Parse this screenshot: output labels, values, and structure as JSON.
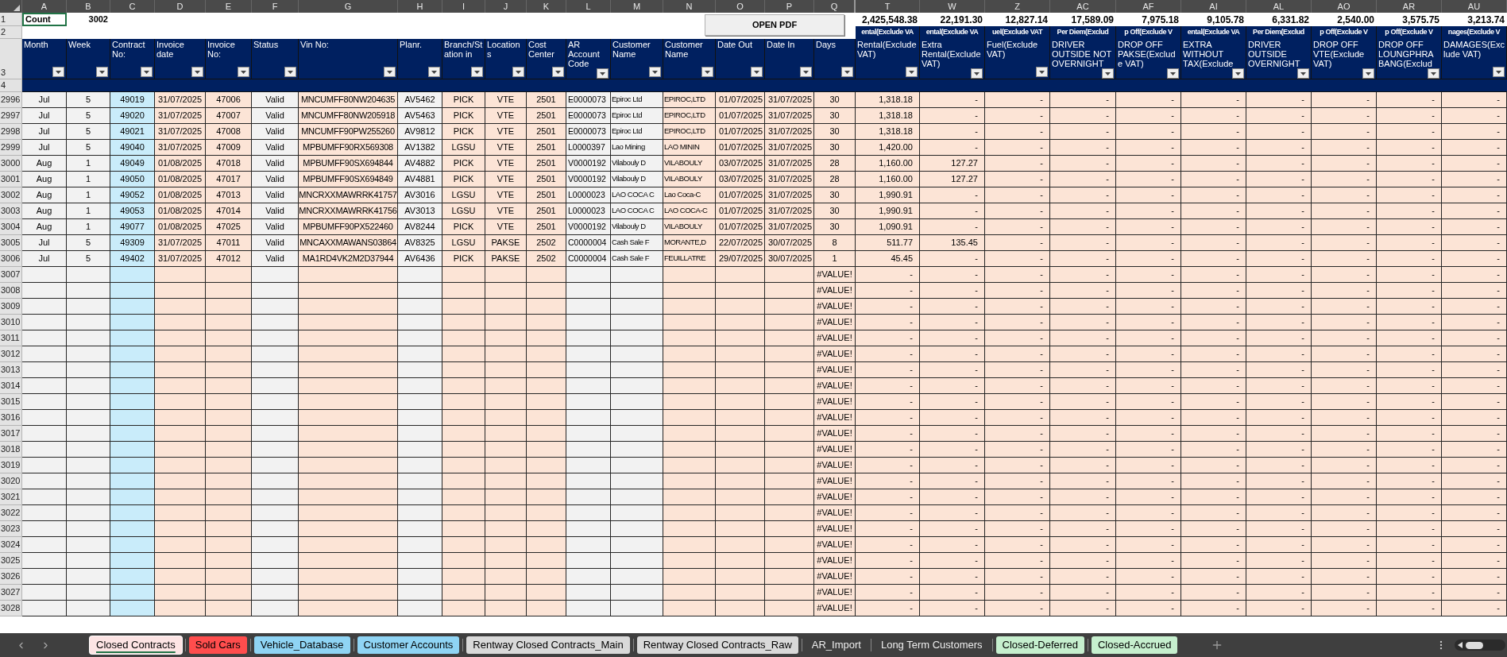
{
  "column_letters": [
    "A",
    "B",
    "C",
    "D",
    "E",
    "F",
    "G",
    "H",
    "I",
    "J",
    "K",
    "L",
    "M",
    "N",
    "O",
    "P",
    "Q",
    "T",
    "W",
    "Z",
    "AC",
    "AF",
    "AI",
    "AL",
    "AO",
    "AR",
    "AU"
  ],
  "top_row_numbers": [
    "1",
    "2",
    "3",
    "4"
  ],
  "row1": {
    "label": "Count",
    "selected": true,
    "count": "3002",
    "totals": [
      "2,425,548.38",
      "22,191.30",
      "12,827.14",
      "17,589.09",
      "7,975.18",
      "9,105.78",
      "6,331.82",
      "2,540.00",
      "3,575.75",
      "3,213.74"
    ]
  },
  "open_pdf_button": "OPEN PDF",
  "group_labels": [
    "ental(Exclude VA",
    "ental(Exclude VA",
    "uel(Exclude VAT",
    "Per Diem(Exclud",
    "p Off(Exclude V",
    "ental(Exclude VA",
    "Per Diem(Exclud",
    "p Off(Exclude V",
    "p Off(Exclude V",
    "nages(Exclude V"
  ],
  "headers": [
    "Month",
    "Week",
    "Contract No:",
    "Invoice date",
    "Invoice No:",
    "Status",
    "Vin No:",
    "Planr.",
    "Branch/Station in",
    "Locations",
    "Cost Center",
    "AR Account Code",
    "Customer Name",
    "Customer Name",
    "Date Out",
    "Date In",
    "Days",
    "Rental(Exclude VAT)",
    "Extra Rental(Exclude VAT)",
    "Fuel(Exclude VAT)",
    "DRIVER OUTSIDE NOT OVERNIGHT",
    "DROP OFF PAKSE(Exclude VAT)",
    "EXTRA WITHOUT TAX(Exclude",
    "DRIVER OUTSIDE OVERNIGHT",
    "DROP OFF VTE(Exclude VAT)",
    "DROP OFF LOUNGPHRABANG(Exclud",
    "DAMAGES(Exclude VAT)"
  ],
  "rows": [
    {
      "number": "2996",
      "cells": [
        "Jul",
        "5",
        "49019",
        "31/07/2025",
        "47006",
        "Valid",
        "MNCUMFF80NW204635",
        "AV5462",
        "PICK",
        "VTE",
        "2501",
        "E0000073",
        "Epiroc Ltd",
        "EPIROC,LTD",
        "01/07/2025",
        "31/07/2025",
        "30",
        "1,318.18",
        "-",
        "-",
        "-",
        "-",
        "-",
        "-",
        "-",
        "-",
        "-"
      ]
    },
    {
      "number": "2997",
      "cells": [
        "Jul",
        "5",
        "49020",
        "31/07/2025",
        "47007",
        "Valid",
        "MNCUMFF80NW205918",
        "AV5463",
        "PICK",
        "VTE",
        "2501",
        "E0000073",
        "Epiroc Ltd",
        "EPIROC,LTD",
        "01/07/2025",
        "31/07/2025",
        "30",
        "1,318.18",
        "-",
        "-",
        "-",
        "-",
        "-",
        "-",
        "-",
        "-",
        "-"
      ]
    },
    {
      "number": "2998",
      "cells": [
        "Jul",
        "5",
        "49021",
        "31/07/2025",
        "47008",
        "Valid",
        "MNCUMFF90PW255260",
        "AV9812",
        "PICK",
        "VTE",
        "2501",
        "E0000073",
        "Epiroc Ltd",
        "EPIROC,LTD",
        "01/07/2025",
        "31/07/2025",
        "30",
        "1,318.18",
        "-",
        "-",
        "-",
        "-",
        "-",
        "-",
        "-",
        "-",
        "-"
      ]
    },
    {
      "number": "2999",
      "cells": [
        "Jul",
        "5",
        "49040",
        "31/07/2025",
        "47009",
        "Valid",
        "MPBUMFF90RX569308",
        "AV1382",
        "LGSU",
        "VTE",
        "2501",
        "L0000397",
        "Lao Mining",
        "LAO MININ",
        "01/07/2025",
        "31/07/2025",
        "30",
        "1,420.00",
        "-",
        "-",
        "-",
        "-",
        "-",
        "-",
        "-",
        "-",
        "-"
      ]
    },
    {
      "number": "3000",
      "cells": [
        "Aug",
        "1",
        "49049",
        "01/08/2025",
        "47018",
        "Valid",
        "MPBUMFF90SX694844",
        "AV4882",
        "PICK",
        "VTE",
        "2501",
        "V0000192",
        "Vilabouly D",
        "VILABOULY",
        "03/07/2025",
        "31/07/2025",
        "28",
        "1,160.00",
        "127.27",
        "-",
        "-",
        "-",
        "-",
        "-",
        "-",
        "-",
        "-"
      ]
    },
    {
      "number": "3001",
      "cells": [
        "Aug",
        "1",
        "49050",
        "01/08/2025",
        "47017",
        "Valid",
        "MPBUMFF90SX694849",
        "AV4881",
        "PICK",
        "VTE",
        "2501",
        "V0000192",
        "Vilabouly D",
        "VILABOULY",
        "03/07/2025",
        "31/07/2025",
        "28",
        "1,160.00",
        "127.27",
        "-",
        "-",
        "-",
        "-",
        "-",
        "-",
        "-",
        "-"
      ]
    },
    {
      "number": "3002",
      "cells": [
        "Aug",
        "1",
        "49052",
        "01/08/2025",
        "47013",
        "Valid",
        "MNCRXXMAWRRK41757",
        "AV3016",
        "LGSU",
        "VTE",
        "2501",
        "L0000023",
        "LAO COCA C",
        "Lao Coca-C",
        "01/07/2025",
        "31/07/2025",
        "30",
        "1,990.91",
        "-",
        "-",
        "-",
        "-",
        "-",
        "-",
        "-",
        "-",
        "-"
      ]
    },
    {
      "number": "3003",
      "cells": [
        "Aug",
        "1",
        "49053",
        "01/08/2025",
        "47014",
        "Valid",
        "MNCRXXMAWRRK41756",
        "AV3013",
        "LGSU",
        "VTE",
        "2501",
        "L0000023",
        "LAO COCA C",
        "LAO COCA-C",
        "01/07/2025",
        "31/07/2025",
        "30",
        "1,990.91",
        "-",
        "-",
        "-",
        "-",
        "-",
        "-",
        "-",
        "-",
        "-"
      ]
    },
    {
      "number": "3004",
      "cells": [
        "Aug",
        "1",
        "49077",
        "01/08/2025",
        "47025",
        "Valid",
        "MPBUMFF90PX522460",
        "AV8244",
        "PICK",
        "VTE",
        "2501",
        "V0000192",
        "Vilabouly D",
        "VILABOULY",
        "01/07/2025",
        "31/07/2025",
        "30",
        "1,090.91",
        "-",
        "-",
        "-",
        "-",
        "-",
        "-",
        "-",
        "-",
        "-"
      ]
    },
    {
      "number": "3005",
      "cells": [
        "Jul",
        "5",
        "49309",
        "31/07/2025",
        "47011",
        "Valid",
        "MNCAXXMAWANS03864",
        "AV8325",
        "LGSU",
        "PAKSE",
        "2502",
        "C0000004",
        "Cash Sale F",
        "MORANTE,D",
        "22/07/2025",
        "30/07/2025",
        "8",
        "511.77",
        "135.45",
        "-",
        "-",
        "-",
        "-",
        "-",
        "-",
        "-",
        "-"
      ]
    },
    {
      "number": "3006",
      "cells": [
        "Jul",
        "5",
        "49402",
        "31/07/2025",
        "47012",
        "Valid",
        "MA1RD4VK2M2D37944",
        "AV6436",
        "PICK",
        "PAKSE",
        "2502",
        "C0000004",
        "Cash Sale F",
        "FEUILLATRE",
        "29/07/2025",
        "30/07/2025",
        "1",
        "45.45",
        "-",
        "-",
        "-",
        "-",
        "-",
        "-",
        "-",
        "-",
        "-"
      ]
    }
  ],
  "empty_rows": [
    {
      "number": "3007",
      "days": "#VALUE!",
      "amounts": [
        "-",
        "-",
        "-",
        "-",
        "-",
        "-",
        "-",
        "-",
        "-",
        "-"
      ]
    },
    {
      "number": "3008",
      "days": "#VALUE!",
      "amounts": [
        "-",
        "-",
        "-",
        "-",
        "-",
        "-",
        "-",
        "-",
        "-",
        "-"
      ]
    },
    {
      "number": "3009",
      "days": "#VALUE!",
      "amounts": [
        "-",
        "-",
        "-",
        "-",
        "-",
        "-",
        "-",
        "-",
        "-",
        "-"
      ]
    },
    {
      "number": "3010",
      "days": "#VALUE!",
      "amounts": [
        "-",
        "-",
        "-",
        "-",
        "-",
        "-",
        "-",
        "-",
        "-",
        "-"
      ]
    },
    {
      "number": "3011",
      "days": "#VALUE!",
      "amounts": [
        "-",
        "-",
        "-",
        "-",
        "-",
        "-",
        "-",
        "-",
        "-",
        "-"
      ]
    },
    {
      "number": "3012",
      "days": "#VALUE!",
      "amounts": [
        "-",
        "-",
        "-",
        "-",
        "-",
        "-",
        "-",
        "-",
        "-",
        "-"
      ]
    },
    {
      "number": "3013",
      "days": "#VALUE!",
      "amounts": [
        "-",
        "-",
        "-",
        "-",
        "-",
        "-",
        "-",
        "-",
        "-",
        "-"
      ]
    },
    {
      "number": "3014",
      "days": "#VALUE!",
      "amounts": [
        "-",
        "-",
        "-",
        "-",
        "-",
        "-",
        "-",
        "-",
        "-",
        "-"
      ]
    },
    {
      "number": "3015",
      "days": "#VALUE!",
      "amounts": [
        "-",
        "-",
        "-",
        "-",
        "-",
        "-",
        "-",
        "-",
        "-",
        "-"
      ]
    },
    {
      "number": "3016",
      "days": "#VALUE!",
      "amounts": [
        "-",
        "-",
        "-",
        "-",
        "-",
        "-",
        "-",
        "-",
        "-",
        "-"
      ]
    },
    {
      "number": "3017",
      "days": "#VALUE!",
      "amounts": [
        "-",
        "-",
        "-",
        "-",
        "-",
        "-",
        "-",
        "-",
        "-",
        "-"
      ]
    },
    {
      "number": "3018",
      "days": "#VALUE!",
      "amounts": [
        "-",
        "-",
        "-",
        "-",
        "-",
        "-",
        "-",
        "-",
        "-",
        "-"
      ]
    },
    {
      "number": "3019",
      "days": "#VALUE!",
      "amounts": [
        "-",
        "-",
        "-",
        "-",
        "-",
        "-",
        "-",
        "-",
        "-",
        "-"
      ]
    },
    {
      "number": "3020",
      "days": "#VALUE!",
      "amounts": [
        "-",
        "-",
        "-",
        "-",
        "-",
        "-",
        "-",
        "-",
        "-",
        "-"
      ]
    },
    {
      "number": "3021",
      "days": "#VALUE!",
      "amounts": [
        "-",
        "-",
        "-",
        "-",
        "-",
        "-",
        "-",
        "-",
        "-",
        "-"
      ]
    },
    {
      "number": "3022",
      "days": "#VALUE!",
      "amounts": [
        "-",
        "-",
        "-",
        "-",
        "-",
        "-",
        "-",
        "-",
        "-",
        "-"
      ]
    },
    {
      "number": "3023",
      "days": "#VALUE!",
      "amounts": [
        "-",
        "-",
        "-",
        "-",
        "-",
        "-",
        "-",
        "-",
        "-",
        "-"
      ]
    },
    {
      "number": "3024",
      "days": "#VALUE!",
      "amounts": [
        "-",
        "-",
        "-",
        "-",
        "-",
        "-",
        "-",
        "-",
        "-",
        "-"
      ]
    },
    {
      "number": "3025",
      "days": "#VALUE!",
      "amounts": [
        "-",
        "-",
        "-",
        "-",
        "-",
        "-",
        "-",
        "-",
        "-",
        "-"
      ]
    },
    {
      "number": "3026",
      "days": "#VALUE!",
      "amounts": [
        "-",
        "-",
        "-",
        "-",
        "-",
        "-",
        "-",
        "-",
        "-",
        "-"
      ]
    },
    {
      "number": "3027",
      "days": "#VALUE!",
      "amounts": [
        "-",
        "-",
        "-",
        "-",
        "-",
        "-",
        "-",
        "-",
        "-",
        "-"
      ]
    },
    {
      "number": "3028",
      "days": "#VALUE!",
      "amounts": [
        "-",
        "-",
        "-",
        "-",
        "-",
        "-",
        "-",
        "-",
        "-",
        "-"
      ]
    }
  ],
  "sheet_tabs": [
    {
      "label": "Closed Contracts",
      "selected": true,
      "color": "#fde4e4"
    },
    {
      "label": "Sold Cars",
      "selected": false,
      "color": "#ff4d4d"
    },
    {
      "label": "Vehicle_Database",
      "selected": false,
      "color": "#8fd4f4"
    },
    {
      "label": "Customer Accounts",
      "selected": false,
      "color": "#8fd4f4"
    },
    {
      "label": "Rentway Closed Contracts_Main",
      "selected": false,
      "color": "#d9d9d9"
    },
    {
      "label": "Rentway Closed Contracts_Raw",
      "selected": false,
      "color": "#d9d9d9"
    },
    {
      "label": "AR_Import",
      "selected": false
    },
    {
      "label": "Long Term Customers",
      "selected": false
    },
    {
      "label": "Closed-Deferred",
      "selected": false,
      "color": "#c6efce"
    },
    {
      "label": "Closed-Accrued",
      "selected": false,
      "color": "#c6efce"
    }
  ]
}
